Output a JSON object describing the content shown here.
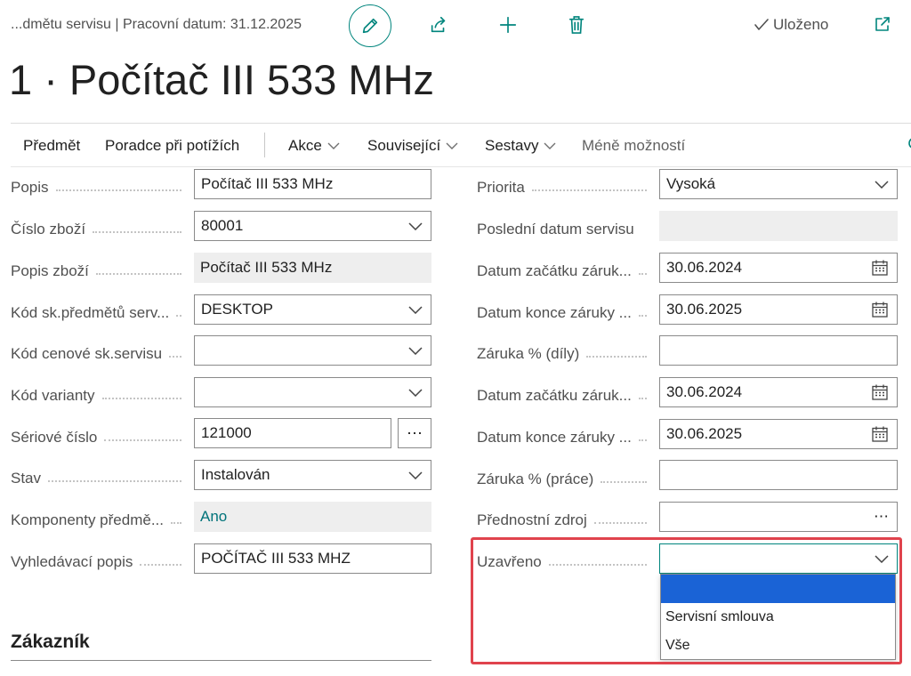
{
  "header": {
    "breadcrumb": "...dmětu servisu | Pracovní datum: 31.12.2025",
    "saved_label": "Uloženo",
    "icons": [
      "pencil-icon",
      "share-icon",
      "plus-icon",
      "trash-icon",
      "checkmark-icon",
      "open-in-new-window-icon"
    ]
  },
  "page_title": "1 · Počítač III 533 MHz",
  "actions": {
    "predmet": "Předmět",
    "poradce": "Poradce při potížích",
    "akce": "Akce",
    "souvisejici": "Související",
    "sestavy": "Sestavy",
    "mene": "Méně možností"
  },
  "left_fields": [
    {
      "label": "Popis",
      "value": "Počítač III 533 MHz"
    },
    {
      "label": "Číslo zboží",
      "value": "80001"
    },
    {
      "label": "Popis zboží",
      "value": "Počítač III 533 MHz"
    },
    {
      "label": "Kód sk.předmětů serv...",
      "value": "DESKTOP"
    },
    {
      "label": "Kód cenové sk.servisu",
      "value": ""
    },
    {
      "label": "Kód varianty",
      "value": ""
    },
    {
      "label": "Sériové číslo",
      "value": "121000"
    },
    {
      "label": "Stav",
      "value": "Instalován"
    },
    {
      "label": "Komponenty předmě...",
      "value": "Ano"
    },
    {
      "label": "Vyhledávací popis",
      "value": "POČÍTAČ III 533 MHZ"
    }
  ],
  "right_fields": [
    {
      "label": "Priorita",
      "value": "Vysoká"
    },
    {
      "label": "Poslední datum servisu",
      "value": ""
    },
    {
      "label": "Datum začátku záruk...",
      "value": "30.06.2024"
    },
    {
      "label": "Datum konce záruky ...",
      "value": "30.06.2025"
    },
    {
      "label": "Záruka % (díly)",
      "value": ""
    },
    {
      "label": "Datum začátku záruk...",
      "value": "30.06.2024"
    },
    {
      "label": "Datum konce záruky ...",
      "value": "30.06.2025"
    },
    {
      "label": "Záruka % (práce)",
      "value": ""
    },
    {
      "label": "Přednostní zdroj",
      "value": ""
    },
    {
      "label": "Uzavřeno",
      "value": ""
    }
  ],
  "dropdown": {
    "options": [
      "",
      "Servisní smlouva",
      "Vše"
    ],
    "selected_index": 0
  },
  "section": {
    "title": "Zákazník"
  },
  "colors": {
    "accent": "#00857d",
    "highlight": "#e0434d",
    "selected": "#1a63d6"
  }
}
